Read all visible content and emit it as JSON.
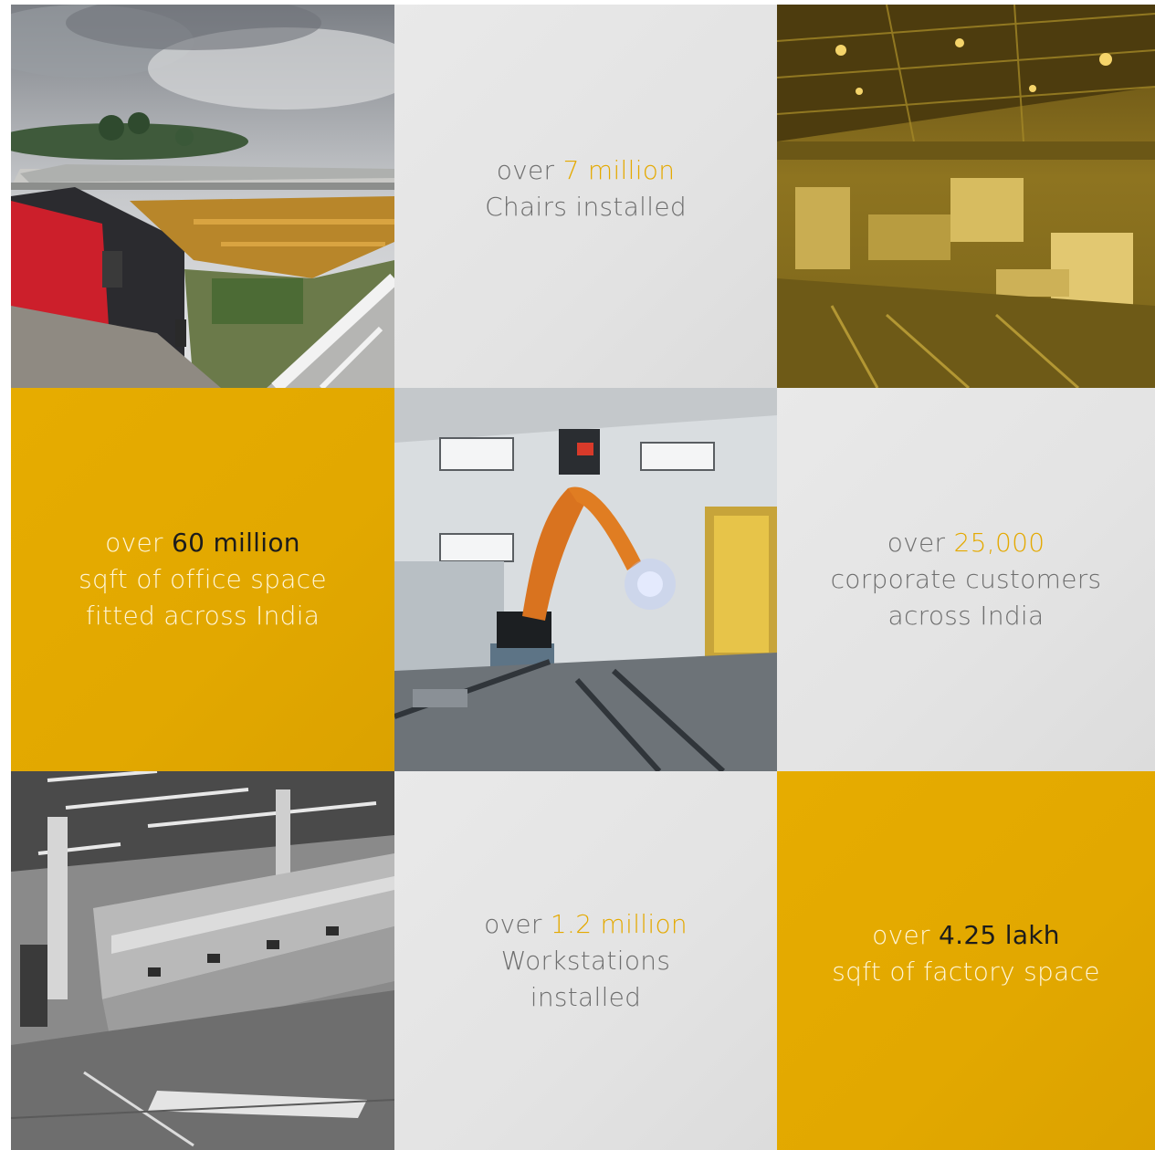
{
  "stats": {
    "chairs": {
      "prefix": "over",
      "highlight": "7 million",
      "lines": [
        "Chairs installed"
      ]
    },
    "office_space": {
      "prefix": "over",
      "highlight": "60 million",
      "lines": [
        "sqft of office space",
        "fitted across India"
      ]
    },
    "customers": {
      "prefix": "over",
      "highlight": "25,000",
      "lines": [
        "corporate customers",
        "across India"
      ]
    },
    "workstations": {
      "prefix": "over",
      "highlight": "1.2 million",
      "lines": [
        "Workstations",
        "installed"
      ]
    },
    "factory_space": {
      "prefix": "over",
      "highlight": "4.25 lakh",
      "lines": [
        "sqft of factory space"
      ]
    }
  },
  "colors": {
    "gold": "#e4a900",
    "grey_tile": "#e6e6e6",
    "grey_text": "#6e6e6e",
    "factory_sign": "#d7222d"
  },
  "photos": {
    "factory_exterior": "photo-icon",
    "assembly_floor_gold": "photo-icon",
    "welding_robot": "photo-icon",
    "cutting_machine_bw": "photo-icon"
  }
}
